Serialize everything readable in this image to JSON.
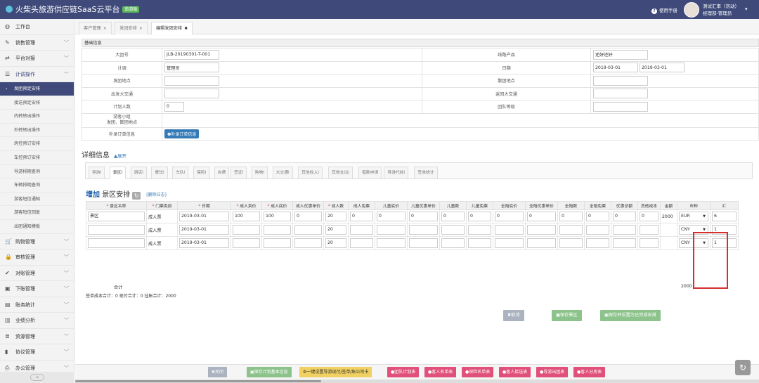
{
  "app": {
    "title": "火柴头旅游供应链SaaS云平台",
    "version_badge": "旅游版"
  },
  "header": {
    "help_label": "使用手册",
    "user_name": "测试汇率（勿动）",
    "user_role": "经理部-管理员"
  },
  "sidebar": {
    "items": [
      {
        "label": "工作台",
        "icon": "dashboard-icon",
        "sym": "◍"
      },
      {
        "label": "销售管理",
        "icon": "edit-icon",
        "sym": "✎"
      },
      {
        "label": "平台对接",
        "icon": "exchange-icon",
        "sym": "⇄"
      },
      {
        "label": "计调操作",
        "icon": "list-icon",
        "sym": "☰",
        "active": true
      }
    ],
    "subitems": [
      "发团预定安排",
      "接送预定安排",
      "内转转出操作",
      "外转转出操作",
      "房控预订安排",
      "车控预订安排",
      "导游排期查询",
      "车辆排期查询",
      "游客短信通知",
      "游客短信回复",
      "出团通知模板"
    ],
    "items_bottom": [
      {
        "label": "购物管理",
        "icon": "cart-icon",
        "sym": "🛒"
      },
      {
        "label": "审核管理",
        "icon": "lock-icon",
        "sym": "🔒"
      },
      {
        "label": "对账管理",
        "icon": "check-icon",
        "sym": "✔"
      },
      {
        "label": "下账管理",
        "icon": "money-icon",
        "sym": "▣"
      },
      {
        "label": "账务统计",
        "icon": "book-icon",
        "sym": "▤"
      },
      {
        "label": "业绩分析",
        "icon": "bar-chart-icon",
        "sym": "▥"
      },
      {
        "label": "资源管理",
        "icon": "database-icon",
        "sym": "≣"
      },
      {
        "label": "协议管理",
        "icon": "file-icon",
        "sym": "▮"
      },
      {
        "label": "办公管理",
        "icon": "print-icon",
        "sym": "⎙"
      }
    ],
    "collapse_label": "«"
  },
  "tabs": [
    {
      "label": "客户管理",
      "close": "×"
    },
    {
      "label": "发团安排",
      "close": "×"
    },
    {
      "label": "编辑发团安排",
      "close": "✖"
    }
  ],
  "basic": {
    "section_title": "基础信息",
    "tour_no_label": "大团号",
    "tour_no": "JLB-20190301-T-001",
    "product_label": "线路产品",
    "product": "还好还好",
    "planner_label": "计调",
    "planner": "管理员",
    "date_label": "日期",
    "date_start": "2019-03-01",
    "date_end": "2019-03-01",
    "depart_place_label": "发团地点",
    "disband_place_label": "散团地点",
    "depart_trans_label": "出发大交通",
    "return_trans_label": "返回大交通",
    "planned_people_label": "计划人数",
    "planned_people": "0",
    "group_level_label": "团队等级",
    "group_label_1": "游客小组",
    "group_label_2": "发团、散团地点",
    "supplement_label": "补录订单信息",
    "supplement_button": "❶补录订单信息"
  },
  "detail": {
    "title": "详细信息",
    "expand": "▲展开"
  },
  "subtabs": [
    "导游ⅰ",
    "景区ⅰ",
    "酒店ⅰ",
    "餐饮ⅰ",
    "车队ⅰ",
    "保险ⅰ",
    "自费",
    "签证ⅰ",
    "购物ⅰ",
    "大交通ⅰ",
    "其他收入ⅰ",
    "其他支出ⅰ",
    "借款申请",
    "导游代收ⅰ",
    "签单统计"
  ],
  "scenic": {
    "add_label": "增加",
    "title": "景区安排",
    "refresh_icon": "↻",
    "delete_log": "[删除日志]",
    "headers": [
      {
        "label": "景区名称",
        "req": true
      },
      {
        "label": "门票类别",
        "req": true
      },
      {
        "label": "日期",
        "req": true
      },
      {
        "label": "成人卖价",
        "req": true
      },
      {
        "label": "成人底价",
        "req": true
      },
      {
        "label": "成人优惠单价",
        "req": false
      },
      {
        "label": "成人数",
        "req": true
      },
      {
        "label": "成人免票",
        "req": false
      },
      {
        "label": "儿童底价",
        "req": false
      },
      {
        "label": "儿童优惠单价",
        "req": false
      },
      {
        "label": "儿童数",
        "req": false
      },
      {
        "label": "儿童免票",
        "req": false
      },
      {
        "label": "全陪底价",
        "req": false
      },
      {
        "label": "全陪优惠单价",
        "req": false
      },
      {
        "label": "全陪数",
        "req": false
      },
      {
        "label": "全陪免票",
        "req": false
      },
      {
        "label": "优惠总额",
        "req": false
      },
      {
        "label": "其他成本",
        "req": false
      },
      {
        "label": "金额",
        "req": false
      },
      {
        "label": "币种",
        "req": false
      },
      {
        "label": "汇",
        "req": false
      }
    ],
    "rows": [
      {
        "name": "景区",
        "ticket": "成人票",
        "date": "2019-03-01",
        "adult_sell": "100",
        "adult_cost": "100",
        "adult_disc": "0",
        "adults": "20",
        "adult_free": "0",
        "child_cost": "0",
        "child_disc": "0",
        "children": "0",
        "child_free": "0",
        "escort_cost": "0",
        "escort_disc": "0",
        "escorts": "0",
        "escort_free": "0",
        "disc_total": "0",
        "other_cost": "0",
        "amount": "2000",
        "currency": "EUR",
        "rate": "6"
      },
      {
        "name": "",
        "ticket": "成人票",
        "date": "2019-03-01",
        "adult_sell": "",
        "adult_cost": "",
        "adult_disc": "",
        "adults": "20",
        "adult_free": "",
        "child_cost": "",
        "child_disc": "",
        "children": "",
        "child_free": "",
        "escort_cost": "",
        "escort_disc": "",
        "escorts": "",
        "escort_free": "",
        "disc_total": "",
        "other_cost": "",
        "amount": "",
        "currency": "CNY",
        "rate": "1"
      },
      {
        "name": "",
        "ticket": "成人票",
        "date": "2019-03-01",
        "adult_sell": "",
        "adult_cost": "",
        "adult_disc": "",
        "adults": "20",
        "adult_free": "",
        "child_cost": "",
        "child_disc": "",
        "children": "",
        "child_free": "",
        "escort_cost": "",
        "escort_disc": "",
        "escorts": "",
        "escort_free": "",
        "disc_total": "",
        "other_cost": "",
        "amount": "",
        "currency": "CNY",
        "rate": "1"
      }
    ],
    "total_label": "合计",
    "total_amount": "2000",
    "summary": "签单成本合计：0   现付合计：0   挂账合计：2000"
  },
  "actions": {
    "cancel": "✖取消",
    "save": "▣保存景区",
    "save_done": "▣保存并设置为已完成安排"
  },
  "bottom_buttons": [
    {
      "label": "✖关闭",
      "color": "#aab3bf"
    },
    {
      "label": "▣保存计划基本信息",
      "color": "#8bc38b"
    },
    {
      "label": "⚙一键设置导游现付/签单/账公司卡",
      "color": "#f0d060",
      "dark": true
    },
    {
      "label": "●团队计划表",
      "color": "#e0507a"
    },
    {
      "label": "●客人名单表",
      "color": "#e0507a"
    },
    {
      "label": "●保险名单表",
      "color": "#e0507a"
    },
    {
      "label": "●客人接送表",
      "color": "#e0507a"
    },
    {
      "label": "●导游出团表",
      "color": "#e0507a"
    },
    {
      "label": "●客人分房表",
      "color": "#e0507a"
    }
  ],
  "colors": {
    "primary": "#3f4a7a",
    "highlight": "#d32f2f",
    "accent_blue": "#337ab7"
  }
}
